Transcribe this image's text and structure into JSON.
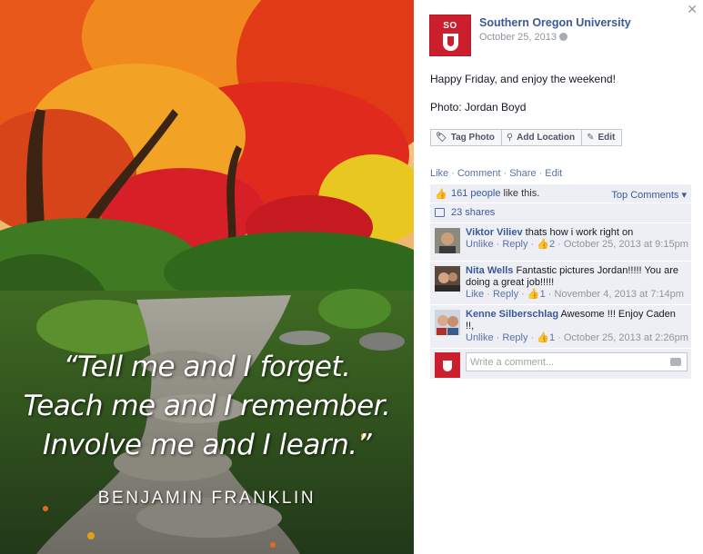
{
  "photo": {
    "quote_lines": [
      "“Tell me and I forget.",
      "Teach me and I remember.",
      "Involve me and I learn.”"
    ],
    "quote_author": "BENJAMIN FRANKLIN"
  },
  "post": {
    "page_name": "Southern Oregon University",
    "logo_text": "SO",
    "date": "October 25, 2013",
    "text": "Happy Friday, and enjoy the weekend!",
    "photo_credit": "Photo: Jordan Boyd",
    "actions": [
      {
        "label": "Tag Photo",
        "icon": "tag-icon"
      },
      {
        "label": "Add Location",
        "icon": "location-pin-icon"
      },
      {
        "label": "Edit",
        "icon": "pencil-icon"
      }
    ],
    "links": {
      "like": "Like",
      "comment": "Comment",
      "share": "Share",
      "edit": "Edit"
    }
  },
  "ufi": {
    "likes_count": "161 people",
    "likes_suffix": " like this.",
    "top_comments": "Top Comments",
    "shares": "23 shares",
    "comments": [
      {
        "author": "Viktor Viliev",
        "text": "thats how i work right on",
        "action": "Unlike",
        "reply": "Reply",
        "likes": "2",
        "time": "October 25, 2013 at 9:15pm"
      },
      {
        "author": "Nita Wells",
        "text": "Fantastic pictures Jordan!!!!! You are doing a great job!!!!!",
        "action": "Like",
        "reply": "Reply",
        "likes": "1",
        "time": "November 4, 2013 at 7:14pm"
      },
      {
        "author": "Kenne Silberschlag",
        "text": "Awesome !!! Enjoy Caden !!,",
        "action": "Unlike",
        "reply": "Reply",
        "likes": "1",
        "time": "October 25, 2013 at 2:26pm"
      }
    ],
    "write_placeholder": "Write a comment..."
  },
  "colors": {
    "link_blue": "#3b5998",
    "brand_red": "#cc1f2e",
    "ufi_background": "#edeff4"
  }
}
